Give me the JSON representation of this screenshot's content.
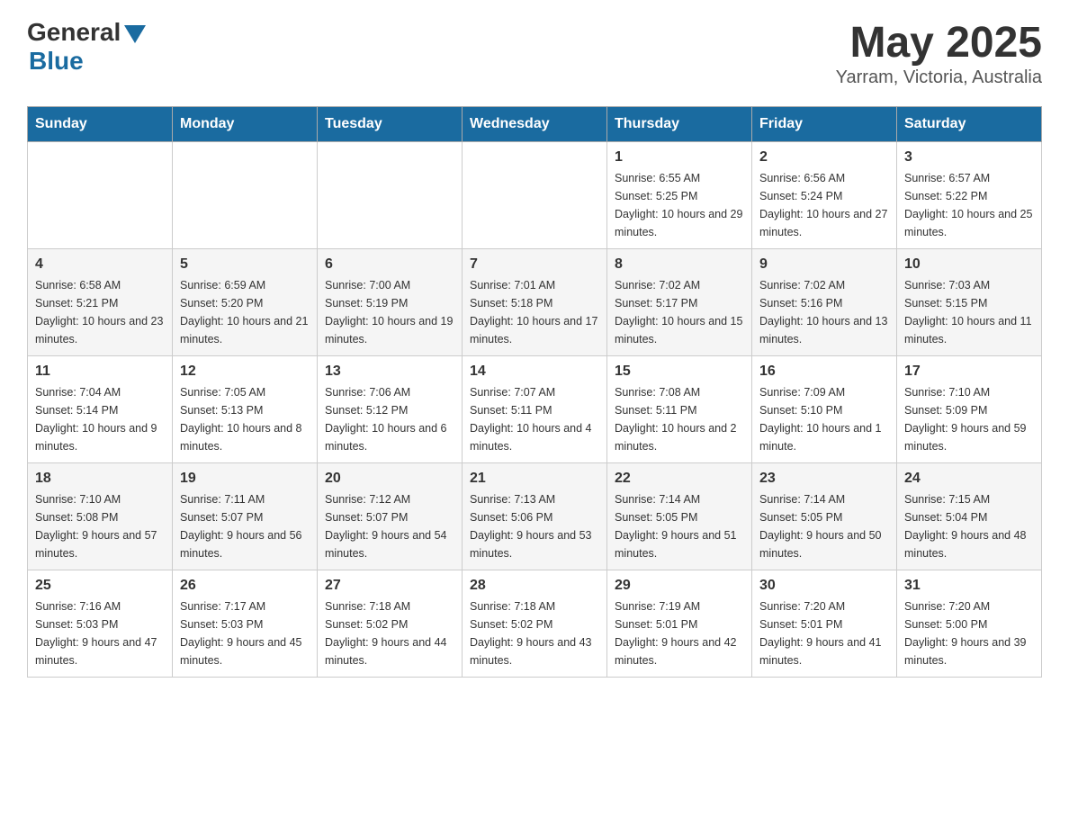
{
  "header": {
    "logo": {
      "general": "General",
      "blue": "Blue"
    },
    "title": "May 2025",
    "location": "Yarram, Victoria, Australia"
  },
  "calendar": {
    "days_of_week": [
      "Sunday",
      "Monday",
      "Tuesday",
      "Wednesday",
      "Thursday",
      "Friday",
      "Saturday"
    ],
    "weeks": [
      [
        {
          "day": "",
          "info": ""
        },
        {
          "day": "",
          "info": ""
        },
        {
          "day": "",
          "info": ""
        },
        {
          "day": "",
          "info": ""
        },
        {
          "day": "1",
          "info": "Sunrise: 6:55 AM\nSunset: 5:25 PM\nDaylight: 10 hours and 29 minutes."
        },
        {
          "day": "2",
          "info": "Sunrise: 6:56 AM\nSunset: 5:24 PM\nDaylight: 10 hours and 27 minutes."
        },
        {
          "day": "3",
          "info": "Sunrise: 6:57 AM\nSunset: 5:22 PM\nDaylight: 10 hours and 25 minutes."
        }
      ],
      [
        {
          "day": "4",
          "info": "Sunrise: 6:58 AM\nSunset: 5:21 PM\nDaylight: 10 hours and 23 minutes."
        },
        {
          "day": "5",
          "info": "Sunrise: 6:59 AM\nSunset: 5:20 PM\nDaylight: 10 hours and 21 minutes."
        },
        {
          "day": "6",
          "info": "Sunrise: 7:00 AM\nSunset: 5:19 PM\nDaylight: 10 hours and 19 minutes."
        },
        {
          "day": "7",
          "info": "Sunrise: 7:01 AM\nSunset: 5:18 PM\nDaylight: 10 hours and 17 minutes."
        },
        {
          "day": "8",
          "info": "Sunrise: 7:02 AM\nSunset: 5:17 PM\nDaylight: 10 hours and 15 minutes."
        },
        {
          "day": "9",
          "info": "Sunrise: 7:02 AM\nSunset: 5:16 PM\nDaylight: 10 hours and 13 minutes."
        },
        {
          "day": "10",
          "info": "Sunrise: 7:03 AM\nSunset: 5:15 PM\nDaylight: 10 hours and 11 minutes."
        }
      ],
      [
        {
          "day": "11",
          "info": "Sunrise: 7:04 AM\nSunset: 5:14 PM\nDaylight: 10 hours and 9 minutes."
        },
        {
          "day": "12",
          "info": "Sunrise: 7:05 AM\nSunset: 5:13 PM\nDaylight: 10 hours and 8 minutes."
        },
        {
          "day": "13",
          "info": "Sunrise: 7:06 AM\nSunset: 5:12 PM\nDaylight: 10 hours and 6 minutes."
        },
        {
          "day": "14",
          "info": "Sunrise: 7:07 AM\nSunset: 5:11 PM\nDaylight: 10 hours and 4 minutes."
        },
        {
          "day": "15",
          "info": "Sunrise: 7:08 AM\nSunset: 5:11 PM\nDaylight: 10 hours and 2 minutes."
        },
        {
          "day": "16",
          "info": "Sunrise: 7:09 AM\nSunset: 5:10 PM\nDaylight: 10 hours and 1 minute."
        },
        {
          "day": "17",
          "info": "Sunrise: 7:10 AM\nSunset: 5:09 PM\nDaylight: 9 hours and 59 minutes."
        }
      ],
      [
        {
          "day": "18",
          "info": "Sunrise: 7:10 AM\nSunset: 5:08 PM\nDaylight: 9 hours and 57 minutes."
        },
        {
          "day": "19",
          "info": "Sunrise: 7:11 AM\nSunset: 5:07 PM\nDaylight: 9 hours and 56 minutes."
        },
        {
          "day": "20",
          "info": "Sunrise: 7:12 AM\nSunset: 5:07 PM\nDaylight: 9 hours and 54 minutes."
        },
        {
          "day": "21",
          "info": "Sunrise: 7:13 AM\nSunset: 5:06 PM\nDaylight: 9 hours and 53 minutes."
        },
        {
          "day": "22",
          "info": "Sunrise: 7:14 AM\nSunset: 5:05 PM\nDaylight: 9 hours and 51 minutes."
        },
        {
          "day": "23",
          "info": "Sunrise: 7:14 AM\nSunset: 5:05 PM\nDaylight: 9 hours and 50 minutes."
        },
        {
          "day": "24",
          "info": "Sunrise: 7:15 AM\nSunset: 5:04 PM\nDaylight: 9 hours and 48 minutes."
        }
      ],
      [
        {
          "day": "25",
          "info": "Sunrise: 7:16 AM\nSunset: 5:03 PM\nDaylight: 9 hours and 47 minutes."
        },
        {
          "day": "26",
          "info": "Sunrise: 7:17 AM\nSunset: 5:03 PM\nDaylight: 9 hours and 45 minutes."
        },
        {
          "day": "27",
          "info": "Sunrise: 7:18 AM\nSunset: 5:02 PM\nDaylight: 9 hours and 44 minutes."
        },
        {
          "day": "28",
          "info": "Sunrise: 7:18 AM\nSunset: 5:02 PM\nDaylight: 9 hours and 43 minutes."
        },
        {
          "day": "29",
          "info": "Sunrise: 7:19 AM\nSunset: 5:01 PM\nDaylight: 9 hours and 42 minutes."
        },
        {
          "day": "30",
          "info": "Sunrise: 7:20 AM\nSunset: 5:01 PM\nDaylight: 9 hours and 41 minutes."
        },
        {
          "day": "31",
          "info": "Sunrise: 7:20 AM\nSunset: 5:00 PM\nDaylight: 9 hours and 39 minutes."
        }
      ]
    ]
  }
}
